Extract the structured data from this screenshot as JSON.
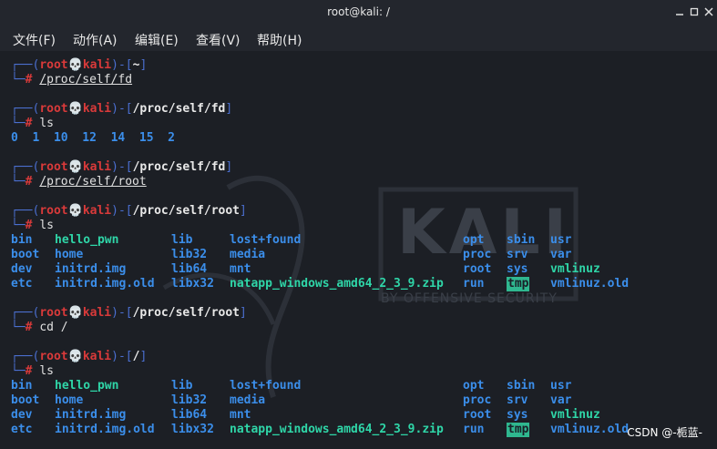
{
  "window": {
    "title": "root@kali: /"
  },
  "menu": [
    {
      "label": "文件(F)"
    },
    {
      "label": "动作(A)"
    },
    {
      "label": "编辑(E)"
    },
    {
      "label": "查看(V)"
    },
    {
      "label": "帮助(H)"
    }
  ],
  "prompt": {
    "user": "root",
    "skull": "💀",
    "host": "kali",
    "hash": "#"
  },
  "blocks": [
    {
      "path": "~",
      "command": "/proc/self/fd",
      "underline": true
    },
    {
      "path": "/proc/self/fd",
      "command": "ls",
      "underline": false,
      "output": "0  1  10  12  14  15  2"
    },
    {
      "path": "/proc/self/fd",
      "command": "/proc/self/root",
      "underline": true
    },
    {
      "path": "/proc/self/root",
      "command": "ls",
      "underline": false
    },
    {
      "path": "/proc/self/root",
      "command": "cd /",
      "underline": false
    },
    {
      "path": "/",
      "command": "ls",
      "underline": false
    }
  ],
  "listing": {
    "rows": [
      [
        "bin",
        "hello_pwn",
        "lib",
        "lost+found",
        "opt",
        "sbin",
        "usr"
      ],
      [
        "boot",
        "home",
        "lib32",
        "media",
        "proc",
        "srv",
        "var"
      ],
      [
        "dev",
        "initrd.img",
        "lib64",
        "mnt",
        "root",
        "sys",
        "vmlinuz"
      ],
      [
        "etc",
        "initrd.img.old",
        "libx32",
        "natapp_windows_amd64_2_3_9.zip",
        "run",
        "tmp",
        "vmlinuz.old"
      ]
    ]
  },
  "watermark": {
    "kali": "KALI",
    "tagline": "BY OFFENSIVE SECURITY"
  },
  "footer": {
    "csdn": "CSDN @-栀蓝-"
  },
  "colors": {
    "frame": "#4b6fd0",
    "user": "#d93a3a",
    "dir": "#3b8eea",
    "exec": "#2fd6a8"
  }
}
